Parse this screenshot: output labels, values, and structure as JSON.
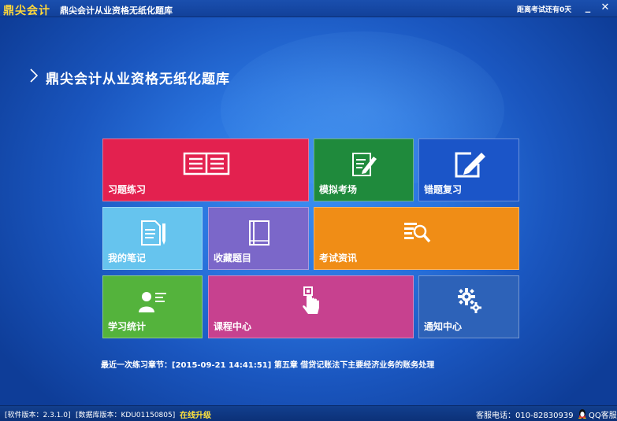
{
  "titlebar": {
    "brand": "鼎尖会计",
    "title": "鼎尖会计从业资格无纸化题库",
    "countdown": "距离考试还有0天",
    "minimize_label": "_",
    "close_label": "✕"
  },
  "headline": {
    "text": "鼎尖会计从业资格无纸化题库"
  },
  "tiles": {
    "practice": "习题练习",
    "exam": "模拟考场",
    "wrong": "错题复习",
    "notes": "我的笔记",
    "fav": "收藏题目",
    "news": "考试资讯",
    "stats": "学习统计",
    "course": "课程中心",
    "notice": "通知中心"
  },
  "recent": {
    "text": "最近一次练习章节：[2015-09-21 14:41:51] 第五章 借贷记账法下主要经济业务的账务处理"
  },
  "statusbar": {
    "version": "[软件版本：2.3.1.0]",
    "db_version": "[数据库版本：KDU01150805]",
    "upgrade": "在线升级",
    "phone": "客服电话：010-82830939",
    "qq": "QQ客服"
  },
  "colors": {
    "practice": "#e3214f",
    "exam": "#1f8a3c",
    "wrong": "#1b55c8",
    "notes": "#66c4ee",
    "fav": "#7b67c9",
    "news": "#f08d16",
    "stats": "#54b33c",
    "course": "#c7418f",
    "notice": "#2d62b8",
    "brand": "#ffd83a",
    "upgrade": "#ffe23d"
  }
}
